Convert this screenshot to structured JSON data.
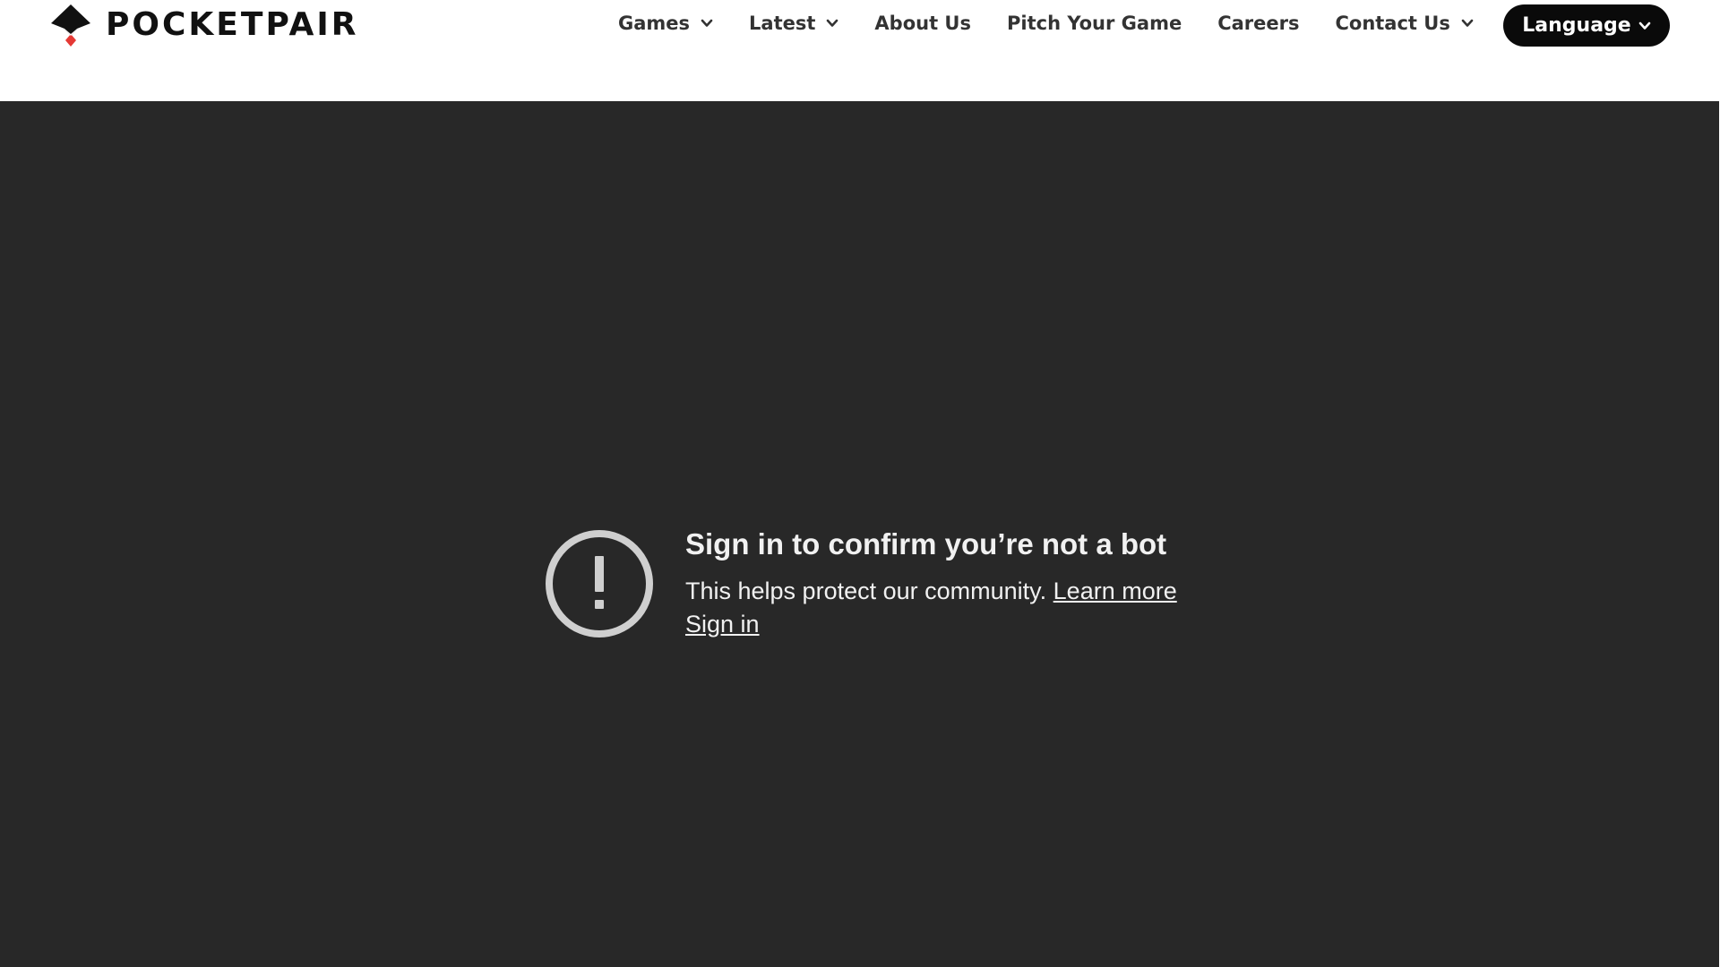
{
  "header": {
    "logo_text": "POCKETPAIR",
    "nav": [
      {
        "label": "Games",
        "has_dropdown": true
      },
      {
        "label": "Latest",
        "has_dropdown": true
      },
      {
        "label": "About Us",
        "has_dropdown": false
      },
      {
        "label": "Pitch Your Game",
        "has_dropdown": false
      },
      {
        "label": "Careers",
        "has_dropdown": false
      },
      {
        "label": "Contact Us",
        "has_dropdown": true
      }
    ],
    "language_label": "Language"
  },
  "embed": {
    "title": "Sign in to confirm you’re not a bot",
    "body": "This helps protect our community.",
    "learn_more_label": "Learn more",
    "sign_in_label": "Sign in",
    "icon": "alert-circle-icon"
  },
  "colors": {
    "embed_background": "#282828",
    "logo_accent": "#e53935",
    "button_background": "#0a0a0a",
    "nav_text": "#333333"
  }
}
